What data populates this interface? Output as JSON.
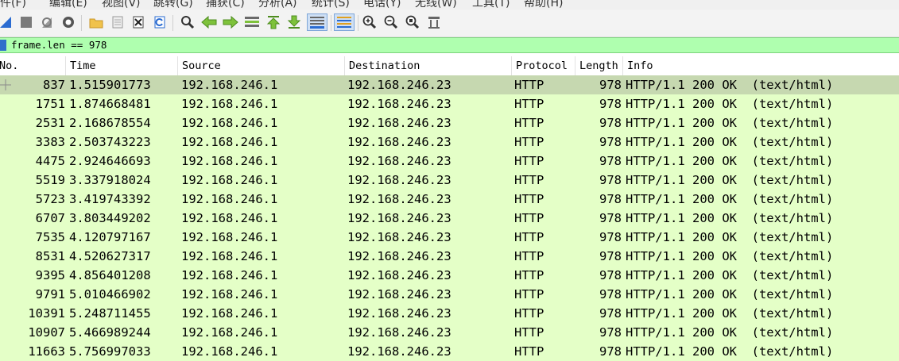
{
  "menu": {
    "items": [
      "文件(F)",
      "编辑(E)",
      "视图(V)",
      "跳转(G)",
      "捕获(C)",
      "分析(A)",
      "统计(S)",
      "电话(Y)",
      "无线(W)",
      "工具(T)",
      "帮助(H)"
    ]
  },
  "toolbar": {
    "icons": [
      "shark-fin-start-icon",
      "stop-capture-icon",
      "restart-capture-icon",
      "capture-options-icon",
      "open-file-icon",
      "save-file-icon",
      "close-file-icon",
      "reload-file-icon",
      "find-packet-icon",
      "go-back-icon",
      "go-forward-icon",
      "go-to-packet-icon",
      "first-packet-icon",
      "last-packet-icon",
      "auto-scroll-icon",
      "colorize-icon",
      "zoom-in-icon",
      "zoom-out-icon",
      "zoom-normal-icon",
      "resize-columns-icon"
    ]
  },
  "filter": {
    "value": "frame.len == 978"
  },
  "columns": {
    "no": "No.",
    "time": "Time",
    "source": "Source",
    "destination": "Destination",
    "protocol": "Protocol",
    "length": "Length",
    "info": "Info"
  },
  "packets": [
    {
      "no": "837",
      "time": "1.515901773",
      "source": "192.168.246.1",
      "destination": "192.168.246.23",
      "protocol": "HTTP",
      "length": "978",
      "info": "HTTP/1.1 200 OK  (text/html)"
    },
    {
      "no": "1751",
      "time": "1.874668481",
      "source": "192.168.246.1",
      "destination": "192.168.246.23",
      "protocol": "HTTP",
      "length": "978",
      "info": "HTTP/1.1 200 OK  (text/html)"
    },
    {
      "no": "2531",
      "time": "2.168678554",
      "source": "192.168.246.1",
      "destination": "192.168.246.23",
      "protocol": "HTTP",
      "length": "978",
      "info": "HTTP/1.1 200 OK  (text/html)"
    },
    {
      "no": "3383",
      "time": "2.503743223",
      "source": "192.168.246.1",
      "destination": "192.168.246.23",
      "protocol": "HTTP",
      "length": "978",
      "info": "HTTP/1.1 200 OK  (text/html)"
    },
    {
      "no": "4475",
      "time": "2.924646693",
      "source": "192.168.246.1",
      "destination": "192.168.246.23",
      "protocol": "HTTP",
      "length": "978",
      "info": "HTTP/1.1 200 OK  (text/html)"
    },
    {
      "no": "5519",
      "time": "3.337918024",
      "source": "192.168.246.1",
      "destination": "192.168.246.23",
      "protocol": "HTTP",
      "length": "978",
      "info": "HTTP/1.1 200 OK  (text/html)"
    },
    {
      "no": "5723",
      "time": "3.419743392",
      "source": "192.168.246.1",
      "destination": "192.168.246.23",
      "protocol": "HTTP",
      "length": "978",
      "info": "HTTP/1.1 200 OK  (text/html)"
    },
    {
      "no": "6707",
      "time": "3.803449202",
      "source": "192.168.246.1",
      "destination": "192.168.246.23",
      "protocol": "HTTP",
      "length": "978",
      "info": "HTTP/1.1 200 OK  (text/html)"
    },
    {
      "no": "7535",
      "time": "4.120797167",
      "source": "192.168.246.1",
      "destination": "192.168.246.23",
      "protocol": "HTTP",
      "length": "978",
      "info": "HTTP/1.1 200 OK  (text/html)"
    },
    {
      "no": "8531",
      "time": "4.520627317",
      "source": "192.168.246.1",
      "destination": "192.168.246.23",
      "protocol": "HTTP",
      "length": "978",
      "info": "HTTP/1.1 200 OK  (text/html)"
    },
    {
      "no": "9395",
      "time": "4.856401208",
      "source": "192.168.246.1",
      "destination": "192.168.246.23",
      "protocol": "HTTP",
      "length": "978",
      "info": "HTTP/1.1 200 OK  (text/html)"
    },
    {
      "no": "9791",
      "time": "5.010466902",
      "source": "192.168.246.1",
      "destination": "192.168.246.23",
      "protocol": "HTTP",
      "length": "978",
      "info": "HTTP/1.1 200 OK  (text/html)"
    },
    {
      "no": "10391",
      "time": "5.248711455",
      "source": "192.168.246.1",
      "destination": "192.168.246.23",
      "protocol": "HTTP",
      "length": "978",
      "info": "HTTP/1.1 200 OK  (text/html)"
    },
    {
      "no": "10907",
      "time": "5.466989244",
      "source": "192.168.246.1",
      "destination": "192.168.246.23",
      "protocol": "HTTP",
      "length": "978",
      "info": "HTTP/1.1 200 OK  (text/html)"
    },
    {
      "no": "11663",
      "time": "5.756997033",
      "source": "192.168.246.1",
      "destination": "192.168.246.23",
      "protocol": "HTTP",
      "length": "978",
      "info": "HTTP/1.1 200 OK  (text/html)"
    }
  ],
  "selected_index": 0,
  "colors": {
    "row_bg": "#e4ffc7",
    "selected_bg": "#c6d8b0",
    "filter_bg": "#afffaf"
  }
}
